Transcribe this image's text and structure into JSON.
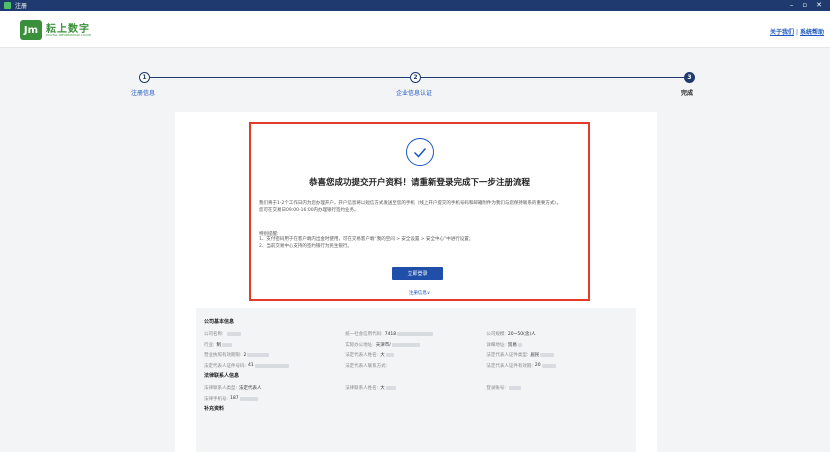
{
  "window": {
    "title": "注册",
    "controls": [
      "–",
      "▫",
      "✕"
    ]
  },
  "header": {
    "logo_mark": "Jm",
    "logo_text": "耘上数字",
    "logo_sub": "DIGITAL INFORMATION CLOUD",
    "links": [
      "关于我们",
      "系统帮助"
    ]
  },
  "steps": [
    {
      "num": "1",
      "label": "注册信息"
    },
    {
      "num": "2",
      "label": "企业信息认证"
    },
    {
      "num": "3",
      "label": "完成"
    }
  ],
  "success": {
    "title": "恭喜您成功提交开户资料！请重新登录完成下一步注册流程",
    "info_lines": [
      "我们将于1-2个工作日内为您办理开户，开户信息将以短信方式发送至您的手机（线上开户提交的手机号码和邮箱附件为我们与您保持联系的重要方式）。",
      "您可在交易日09:00-16:00内办理银行签约业务。"
    ],
    "tips_title": "特别提醒:",
    "tips": [
      "1、支付密码用于在客户端内出金时使用，可在交易客户端“我的空间 > 安全设置 > 安全中心”中进行设置；",
      "2、当前交易中心支持的签约银行为民生银行。"
    ],
    "login_button": "立即登录",
    "register_link": "注册信息∨"
  },
  "company": {
    "section_title": "公司基本信息",
    "rows": [
      [
        {
          "label": "公司名称:",
          "value": ""
        },
        {
          "label": "统一社会信用代码:",
          "value": "7418"
        },
        {
          "label": "公司规模:",
          "value": "20~50(含)人"
        }
      ],
      [
        {
          "label": "行业:",
          "value": "制"
        },
        {
          "label": "实际办公地址:",
          "value": "天津市/"
        },
        {
          "label": "详细地址:",
          "value": "贸易"
        }
      ],
      [
        {
          "label": "营业执照有效期限:",
          "value": "2"
        },
        {
          "label": "法定代表人姓名:",
          "value": "大"
        },
        {
          "label": "法定代表人证件类型:",
          "value": "居民"
        }
      ],
      [
        {
          "label": "法定代表人证件号码:",
          "value": "41"
        },
        {
          "label": "法定代表人联系方式:",
          "value": ""
        },
        {
          "label": "法定代表人证件有效期:",
          "value": "20"
        }
      ]
    ]
  },
  "contact": {
    "section_title": "法律联系人信息",
    "rows": [
      [
        {
          "label": "法律联系人类型:",
          "value": "法定代表人"
        },
        {
          "label": "法律联系人姓名:",
          "value": "大"
        },
        {
          "label": "登录账号:",
          "value": ""
        }
      ],
      [
        {
          "label": "法律手机号:",
          "value": "187"
        },
        {
          "label": "",
          "value": ""
        },
        {
          "label": "",
          "value": ""
        }
      ]
    ],
    "more_title": "补充资料"
  }
}
